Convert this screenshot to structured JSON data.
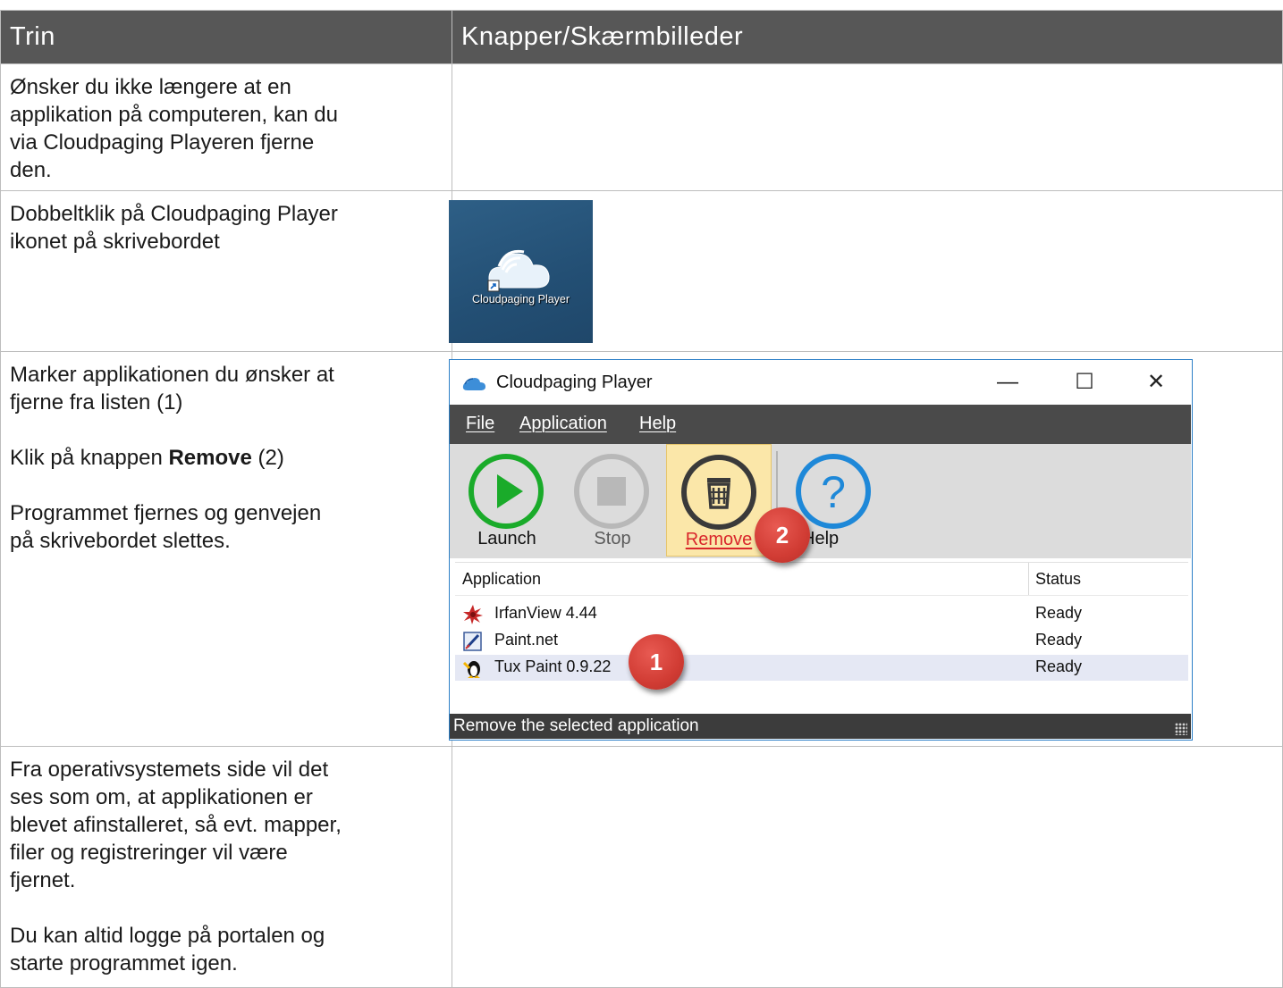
{
  "table": {
    "headers": [
      "Trin",
      "Knapper/Skærmbilleder"
    ],
    "rows": [
      {
        "text": "Ønsker du ikke længere at en\napplikation på computeren, kan du\nvia Cloudpaging Playeren fjerne\nden."
      },
      {
        "text": "Dobbeltklik på Cloudpaging Player\nikonet på skrivebordet"
      },
      {
        "text_a": "Marker applikationen du ønsker at\nfjerne fra listen (1)",
        "text_b_pre": "Klik på knappen ",
        "text_b_bold": "Remove",
        "text_b_post": " (2)",
        "text_c": "Programmet fjernes og genvejen\npå skrivebordet slettes."
      },
      {
        "text_a": "Fra operativsystemets side vil det\nses som om, at applikationen er\nblevet afinstalleret, så evt. mapper,\nfiler og registreringer vil være\nfjernet.",
        "text_b": "Du kan altid logge på portalen og\nstarte programmet igen."
      }
    ]
  },
  "desktop_icon": {
    "label": "Cloudpaging Player",
    "icon": "cloudpaging-icon"
  },
  "player_window": {
    "title": "Cloudpaging Player",
    "controls": {
      "minimize": "—",
      "maximize": "☐",
      "close": "✕"
    },
    "menu": [
      "File",
      "Application",
      "Help"
    ],
    "toolbar": [
      {
        "label": "Launch",
        "icon": "play-icon"
      },
      {
        "label": "Stop",
        "icon": "stop-icon"
      },
      {
        "label": "Remove",
        "icon": "trash-icon"
      },
      {
        "label": "Help",
        "icon": "help-icon"
      }
    ],
    "list_headers": [
      "Application",
      "Status"
    ],
    "apps": [
      {
        "name": "IrfanView 4.44",
        "status": "Ready",
        "icon": "irfanview-icon"
      },
      {
        "name": "Paint.net",
        "status": "Ready",
        "icon": "paintnet-icon"
      },
      {
        "name": "Tux Paint 0.9.22",
        "status": "Ready",
        "icon": "tuxpaint-icon",
        "selected": true
      }
    ],
    "statusbar": "Remove the selected application"
  },
  "callouts": {
    "one": "1",
    "two": "2"
  },
  "colors": {
    "header_bg": "#575757",
    "accent": "#2c7fc7",
    "badge": "#d13c34",
    "launch_green": "#1aab2a",
    "help_blue": "#1e88d8"
  }
}
